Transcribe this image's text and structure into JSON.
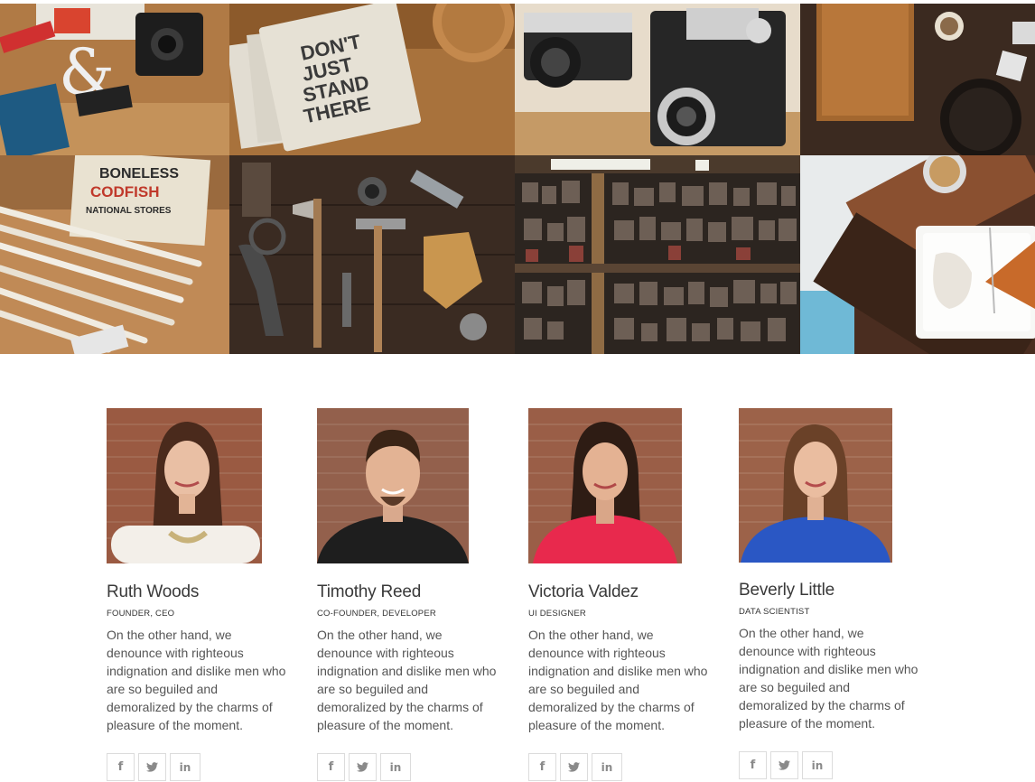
{
  "gallery": {
    "images": [
      {
        "name": "desk-with-camera-and-ampersand"
      },
      {
        "name": "notebooks-dont-just-stand-there"
      },
      {
        "name": "vintage-cameras"
      },
      {
        "name": "cutting-board-and-pan"
      },
      {
        "name": "pencils-and-codfish-box"
      },
      {
        "name": "vintage-tools"
      },
      {
        "name": "wooden-letterpress-type"
      },
      {
        "name": "cake-on-plate-with-coffee"
      }
    ],
    "notebook_text": "DON'T JUST STAND THERE",
    "codfish_text": "BONELESS CODFISH NATIONAL STORES"
  },
  "team": [
    {
      "name": "Ruth Woods",
      "role": "FOUNDER, CEO",
      "bio": "On the other hand, we denounce with righteous indignation and dislike men who are so beguiled and demoralized by the charms of pleasure of the moment.",
      "social": {
        "facebook": "f",
        "twitter": "twitter",
        "linkedin": "in"
      }
    },
    {
      "name": "Timothy Reed",
      "role": "CO-FOUNDER, DEVELOPER",
      "bio": "On the other hand, we denounce with righteous indignation and dislike men who are so beguiled and demoralized by the charms of pleasure of the moment.",
      "social": {
        "facebook": "f",
        "twitter": "twitter",
        "linkedin": "in"
      }
    },
    {
      "name": "Victoria Valdez",
      "role": "UI DESIGNER",
      "bio": "On the other hand, we denounce with righteous indignation and dislike men who are so beguiled and demoralized by the charms of pleasure of the moment.",
      "social": {
        "facebook": "f",
        "twitter": "twitter",
        "linkedin": "in"
      }
    },
    {
      "name": "Beverly Little",
      "role": "DATA SCIENTIST",
      "bio": "On the other hand, we denounce with righteous indignation and dislike men who are so beguiled and demoralized by the charms of pleasure of the moment.",
      "social": {
        "facebook": "f",
        "twitter": "twitter",
        "linkedin": "in"
      }
    }
  ],
  "colors": {
    "background": "#ffffff",
    "name_text": "#3a3a3a",
    "bio_text": "#555555",
    "social_border": "#dcdcdc",
    "social_icon": "#8a8a8a",
    "brick": "#9a5a42"
  }
}
